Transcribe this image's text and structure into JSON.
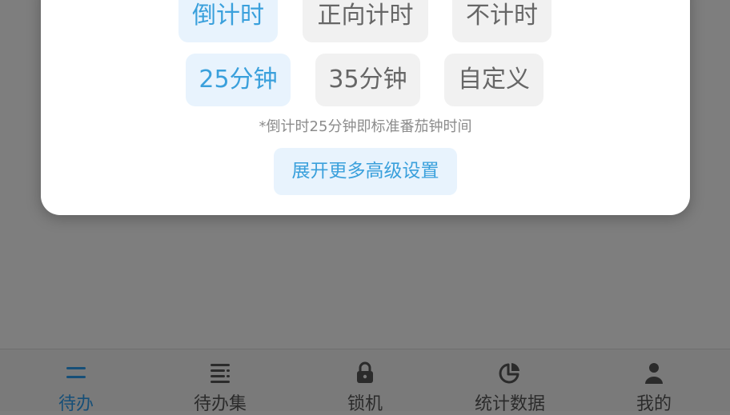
{
  "timer_dialog": {
    "mode_options": [
      {
        "label": "倒计时",
        "selected": true
      },
      {
        "label": "正向计时",
        "selected": false
      },
      {
        "label": "不计时",
        "selected": false
      }
    ],
    "duration_options": [
      {
        "label": "25分钟",
        "selected": true
      },
      {
        "label": "35分钟",
        "selected": false
      },
      {
        "label": "自定义",
        "selected": false
      }
    ],
    "hint": "*倒计时25分钟即标准番茄钟时间",
    "expand_button": "展开更多高级设置"
  },
  "bottom_nav": {
    "items": [
      {
        "label": "待办",
        "icon": "todo-list-icon",
        "active": true
      },
      {
        "label": "待办集",
        "icon": "todo-collection-icon",
        "active": false
      },
      {
        "label": "锁机",
        "icon": "lock-icon",
        "active": false
      },
      {
        "label": "统计数据",
        "icon": "pie-chart-icon",
        "active": false
      },
      {
        "label": "我的",
        "icon": "user-icon",
        "active": false
      }
    ]
  },
  "colors": {
    "accent": "#3aa0dc",
    "selected_bg": "#e8f3fd",
    "option_bg": "#f1f1f1",
    "overlay": "#7e7e7e",
    "nav_active": "#164f78"
  }
}
